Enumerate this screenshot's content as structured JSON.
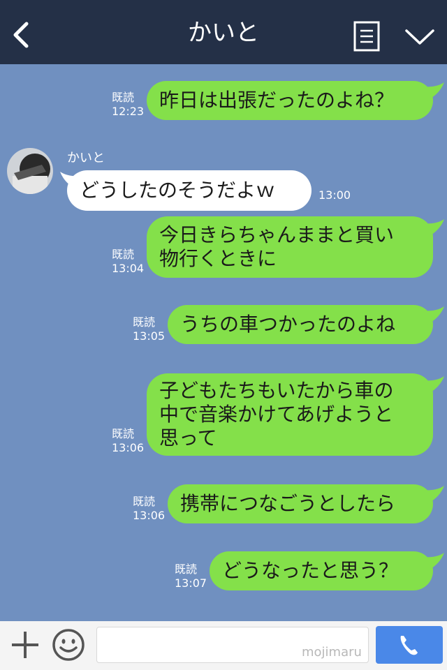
{
  "header": {
    "title": "かいと",
    "back_icon": "chevron-left-icon",
    "menu_icon": "list-icon",
    "dropdown_icon": "chevron-down-icon"
  },
  "colors": {
    "header_bg": "#243047",
    "chat_bg": "#7090c0",
    "outgoing_bubble": "#84e04a",
    "incoming_bubble": "#ffffff",
    "call_button": "#4a88e8"
  },
  "incoming": {
    "sender": "かいと",
    "text": "どうしたのそうだよｗ",
    "time": "13:00"
  },
  "messages": [
    {
      "lines": [
        "昨日は出張だったのよね？"
      ],
      "read": "既読",
      "time": "12:23"
    },
    {
      "lines": [
        "今日きらちゃんままと買い",
        "物行くときに"
      ],
      "read": "既読",
      "time": "13:04"
    },
    {
      "lines": [
        "うちの車つかったのよね"
      ],
      "read": "既読",
      "time": "13:05"
    },
    {
      "lines": [
        "子どもたちもいたから車の",
        "中で音楽かけてあげようと",
        "思って"
      ],
      "read": "既読",
      "time": "13:06"
    },
    {
      "lines": [
        "携帯につなごうとしたら"
      ],
      "read": "既読",
      "time": "13:06"
    },
    {
      "lines": [
        "どうなったと思う？"
      ],
      "read": "既読",
      "time": "13:07"
    }
  ],
  "footer": {
    "plus_icon": "plus-icon",
    "emoji_icon": "smiley-icon",
    "call_icon": "phone-icon",
    "input_value": "",
    "watermark": "mojimaru"
  }
}
